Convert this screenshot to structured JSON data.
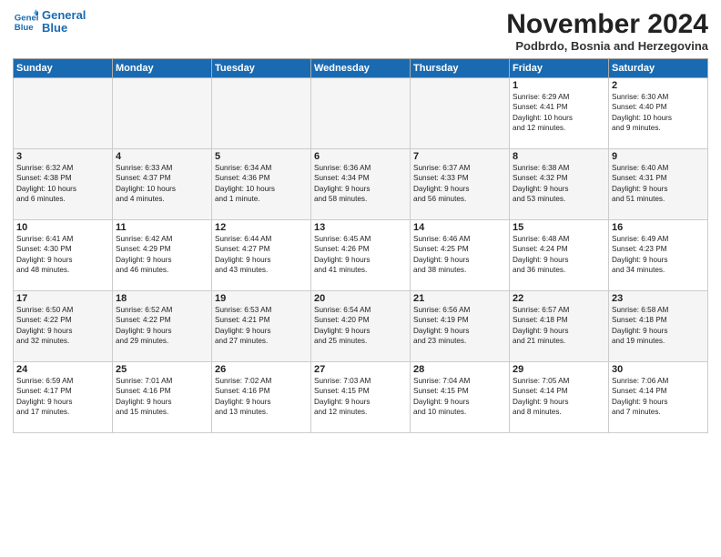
{
  "logo": {
    "line1": "General",
    "line2": "Blue"
  },
  "title": "November 2024",
  "location": "Podbrdo, Bosnia and Herzegovina",
  "days_of_week": [
    "Sunday",
    "Monday",
    "Tuesday",
    "Wednesday",
    "Thursday",
    "Friday",
    "Saturday"
  ],
  "weeks": [
    [
      {
        "day": "",
        "info": "",
        "empty": true
      },
      {
        "day": "",
        "info": "",
        "empty": true
      },
      {
        "day": "",
        "info": "",
        "empty": true
      },
      {
        "day": "",
        "info": "",
        "empty": true
      },
      {
        "day": "",
        "info": "",
        "empty": true
      },
      {
        "day": "1",
        "info": "Sunrise: 6:29 AM\nSunset: 4:41 PM\nDaylight: 10 hours\nand 12 minutes."
      },
      {
        "day": "2",
        "info": "Sunrise: 6:30 AM\nSunset: 4:40 PM\nDaylight: 10 hours\nand 9 minutes."
      }
    ],
    [
      {
        "day": "3",
        "info": "Sunrise: 6:32 AM\nSunset: 4:38 PM\nDaylight: 10 hours\nand 6 minutes."
      },
      {
        "day": "4",
        "info": "Sunrise: 6:33 AM\nSunset: 4:37 PM\nDaylight: 10 hours\nand 4 minutes."
      },
      {
        "day": "5",
        "info": "Sunrise: 6:34 AM\nSunset: 4:36 PM\nDaylight: 10 hours\nand 1 minute."
      },
      {
        "day": "6",
        "info": "Sunrise: 6:36 AM\nSunset: 4:34 PM\nDaylight: 9 hours\nand 58 minutes."
      },
      {
        "day": "7",
        "info": "Sunrise: 6:37 AM\nSunset: 4:33 PM\nDaylight: 9 hours\nand 56 minutes."
      },
      {
        "day": "8",
        "info": "Sunrise: 6:38 AM\nSunset: 4:32 PM\nDaylight: 9 hours\nand 53 minutes."
      },
      {
        "day": "9",
        "info": "Sunrise: 6:40 AM\nSunset: 4:31 PM\nDaylight: 9 hours\nand 51 minutes."
      }
    ],
    [
      {
        "day": "10",
        "info": "Sunrise: 6:41 AM\nSunset: 4:30 PM\nDaylight: 9 hours\nand 48 minutes."
      },
      {
        "day": "11",
        "info": "Sunrise: 6:42 AM\nSunset: 4:29 PM\nDaylight: 9 hours\nand 46 minutes."
      },
      {
        "day": "12",
        "info": "Sunrise: 6:44 AM\nSunset: 4:27 PM\nDaylight: 9 hours\nand 43 minutes."
      },
      {
        "day": "13",
        "info": "Sunrise: 6:45 AM\nSunset: 4:26 PM\nDaylight: 9 hours\nand 41 minutes."
      },
      {
        "day": "14",
        "info": "Sunrise: 6:46 AM\nSunset: 4:25 PM\nDaylight: 9 hours\nand 38 minutes."
      },
      {
        "day": "15",
        "info": "Sunrise: 6:48 AM\nSunset: 4:24 PM\nDaylight: 9 hours\nand 36 minutes."
      },
      {
        "day": "16",
        "info": "Sunrise: 6:49 AM\nSunset: 4:23 PM\nDaylight: 9 hours\nand 34 minutes."
      }
    ],
    [
      {
        "day": "17",
        "info": "Sunrise: 6:50 AM\nSunset: 4:22 PM\nDaylight: 9 hours\nand 32 minutes."
      },
      {
        "day": "18",
        "info": "Sunrise: 6:52 AM\nSunset: 4:22 PM\nDaylight: 9 hours\nand 29 minutes."
      },
      {
        "day": "19",
        "info": "Sunrise: 6:53 AM\nSunset: 4:21 PM\nDaylight: 9 hours\nand 27 minutes."
      },
      {
        "day": "20",
        "info": "Sunrise: 6:54 AM\nSunset: 4:20 PM\nDaylight: 9 hours\nand 25 minutes."
      },
      {
        "day": "21",
        "info": "Sunrise: 6:56 AM\nSunset: 4:19 PM\nDaylight: 9 hours\nand 23 minutes."
      },
      {
        "day": "22",
        "info": "Sunrise: 6:57 AM\nSunset: 4:18 PM\nDaylight: 9 hours\nand 21 minutes."
      },
      {
        "day": "23",
        "info": "Sunrise: 6:58 AM\nSunset: 4:18 PM\nDaylight: 9 hours\nand 19 minutes."
      }
    ],
    [
      {
        "day": "24",
        "info": "Sunrise: 6:59 AM\nSunset: 4:17 PM\nDaylight: 9 hours\nand 17 minutes."
      },
      {
        "day": "25",
        "info": "Sunrise: 7:01 AM\nSunset: 4:16 PM\nDaylight: 9 hours\nand 15 minutes."
      },
      {
        "day": "26",
        "info": "Sunrise: 7:02 AM\nSunset: 4:16 PM\nDaylight: 9 hours\nand 13 minutes."
      },
      {
        "day": "27",
        "info": "Sunrise: 7:03 AM\nSunset: 4:15 PM\nDaylight: 9 hours\nand 12 minutes."
      },
      {
        "day": "28",
        "info": "Sunrise: 7:04 AM\nSunset: 4:15 PM\nDaylight: 9 hours\nand 10 minutes."
      },
      {
        "day": "29",
        "info": "Sunrise: 7:05 AM\nSunset: 4:14 PM\nDaylight: 9 hours\nand 8 minutes."
      },
      {
        "day": "30",
        "info": "Sunrise: 7:06 AM\nSunset: 4:14 PM\nDaylight: 9 hours\nand 7 minutes."
      }
    ]
  ]
}
